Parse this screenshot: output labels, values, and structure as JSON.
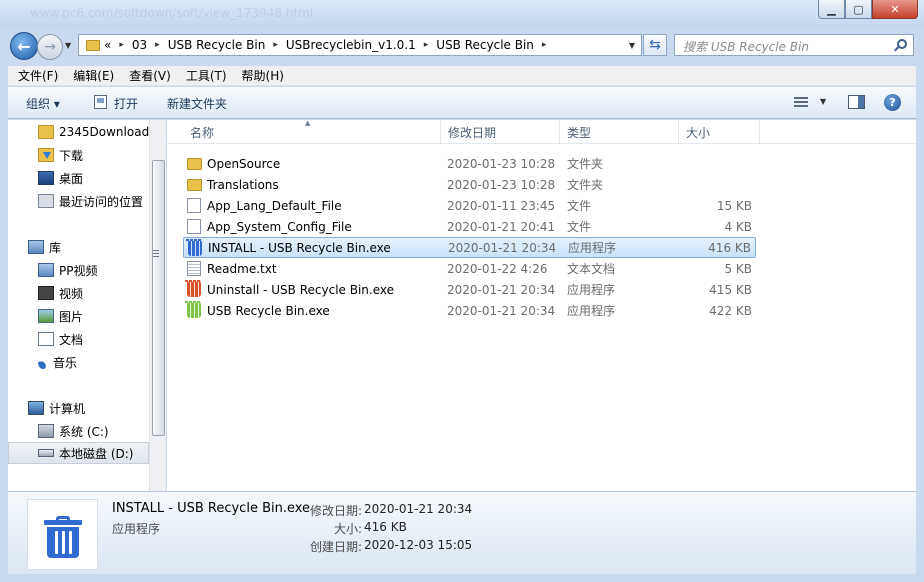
{
  "window": {
    "ghost_title": "www.pc6.com/softdown/soft/view_173948.html",
    "minimize": "▁",
    "maximize": "▢",
    "close": "✕"
  },
  "address": {
    "overflow": "«",
    "crumbs": [
      "03",
      "USB Recycle Bin",
      "USBrecyclebin_v1.0.1",
      "USB Recycle Bin"
    ],
    "search_placeholder": "搜索 USB Recycle Bin"
  },
  "menu": [
    "文件(F)",
    "编辑(E)",
    "查看(V)",
    "工具(T)",
    "帮助(H)"
  ],
  "toolbar": {
    "organize": "组织 ▾",
    "open": "打开",
    "new_folder": "新建文件夹"
  },
  "nav": {
    "items": [
      {
        "label": "2345Downloads",
        "icon": "folder-icon"
      },
      {
        "label": "下载",
        "icon": "downloads-icon"
      },
      {
        "label": "桌面",
        "icon": "desktop-icon"
      },
      {
        "label": "最近访问的位置",
        "icon": "recent-places-icon"
      },
      {
        "label": "库",
        "icon": "library-icon"
      },
      {
        "label": "PP视频",
        "icon": "video-library-icon"
      },
      {
        "label": "视频",
        "icon": "video-icon"
      },
      {
        "label": "图片",
        "icon": "pictures-icon"
      },
      {
        "label": "文档",
        "icon": "documents-icon"
      },
      {
        "label": "音乐",
        "icon": "music-icon"
      },
      {
        "label": "计算机",
        "icon": "computer-icon"
      },
      {
        "label": "系统 (C:)",
        "icon": "drive-c-icon"
      },
      {
        "label": "本地磁盘 (D:)",
        "icon": "drive-d-icon"
      }
    ]
  },
  "columns": {
    "name": "名称",
    "date": "修改日期",
    "type": "类型",
    "size": "大小"
  },
  "files": [
    {
      "name": "OpenSource",
      "date": "2020-01-23 10:28",
      "type": "文件夹",
      "size": "",
      "icon": "folder-icon"
    },
    {
      "name": "Translations",
      "date": "2020-01-23 10:28",
      "type": "文件夹",
      "size": "",
      "icon": "folder-icon"
    },
    {
      "name": "App_Lang_Default_File",
      "date": "2020-01-11 23:45",
      "type": "文件",
      "size": "15 KB",
      "icon": "file-icon"
    },
    {
      "name": "App_System_Config_File",
      "date": "2020-01-21 20:41",
      "type": "文件",
      "size": "4 KB",
      "icon": "file-icon"
    },
    {
      "name": "INSTALL - USB Recycle Bin.exe",
      "date": "2020-01-21 20:34",
      "type": "应用程序",
      "size": "416 KB",
      "icon": "recycle-bin-blue-icon"
    },
    {
      "name": "Readme.txt",
      "date": "2020-01-22 4:26",
      "type": "文本文档",
      "size": "5 KB",
      "icon": "text-file-icon"
    },
    {
      "name": "Uninstall - USB Recycle Bin.exe",
      "date": "2020-01-21 20:34",
      "type": "应用程序",
      "size": "415 KB",
      "icon": "recycle-bin-red-icon"
    },
    {
      "name": "USB Recycle Bin.exe",
      "date": "2020-01-21 20:34",
      "type": "应用程序",
      "size": "422 KB",
      "icon": "recycle-bin-green-icon"
    }
  ],
  "details": {
    "name": "INSTALL - USB Recycle Bin.exe",
    "type": "应用程序",
    "modified_label": "修改日期:",
    "modified": "2020-01-21 20:34",
    "size_label": "大小:",
    "size": "416 KB",
    "created_label": "创建日期:",
    "created": "2020-12-03 15:05"
  },
  "colors": {
    "selection": "#cce4fa",
    "chrome": "#c9daee",
    "install_icon": "#2f6bd0",
    "uninstall_icon": "#d8532c",
    "app_icon": "#7ec648"
  }
}
